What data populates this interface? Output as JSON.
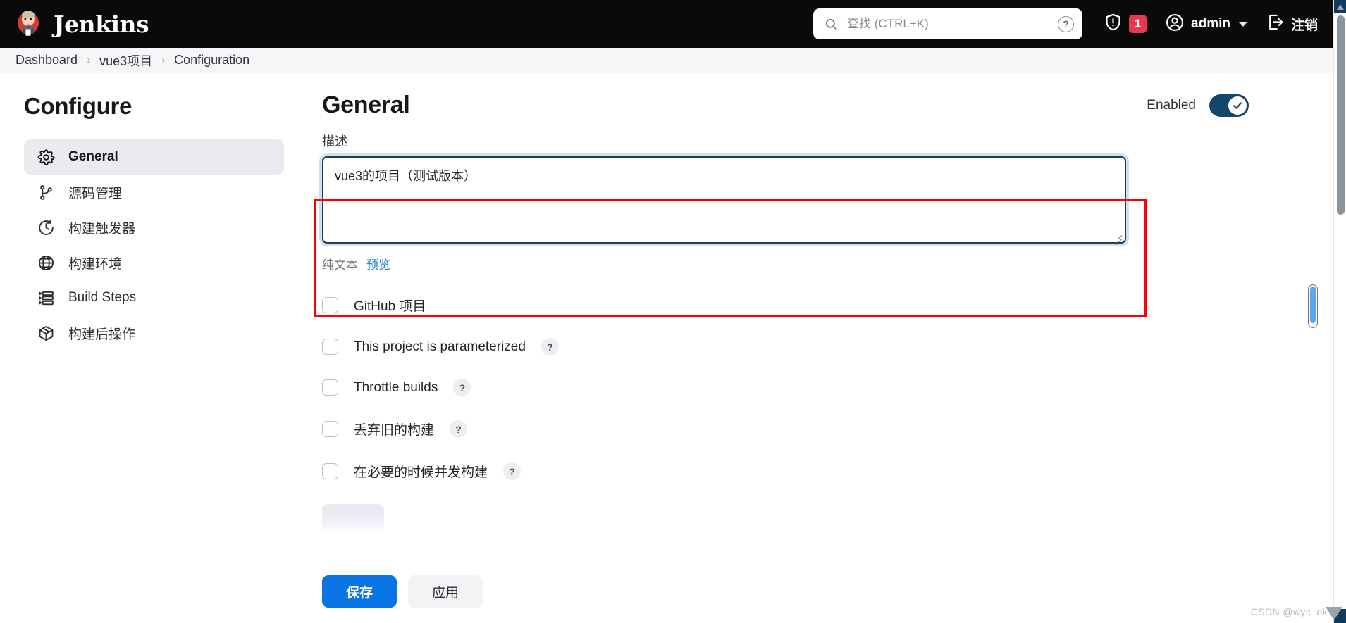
{
  "header": {
    "brand": "Jenkins",
    "search": {
      "placeholder": "查找 (CTRL+K)",
      "value": "",
      "help_label": "?"
    },
    "notifications": {
      "count": "1",
      "icon": "shield-warning-icon"
    },
    "user": {
      "name": "admin",
      "icon": "user-circle-icon"
    },
    "logout": {
      "label": "注销",
      "icon": "logout-icon"
    }
  },
  "breadcrumb": {
    "items": [
      "Dashboard",
      "vue3项目",
      "Configuration"
    ],
    "separator": "›"
  },
  "sidebar": {
    "title": "Configure",
    "items": [
      {
        "label": "General",
        "icon": "gear-icon",
        "active": true
      },
      {
        "label": "源码管理",
        "icon": "git-branch-icon",
        "active": false
      },
      {
        "label": "构建触发器",
        "icon": "clock-icon",
        "active": false
      },
      {
        "label": "构建环境",
        "icon": "globe-icon",
        "active": false
      },
      {
        "label": "Build Steps",
        "icon": "list-steps-icon",
        "active": false
      },
      {
        "label": "构建后操作",
        "icon": "package-box-icon",
        "active": false
      }
    ]
  },
  "main": {
    "title": "General",
    "enabled_toggle": {
      "label": "Enabled",
      "checked": true,
      "color": "#14456b"
    },
    "description": {
      "label": "描述",
      "value": "vue3的项目（测试版本）",
      "plain_text_label": "纯文本",
      "preview_label": "预览"
    },
    "checkboxes": [
      {
        "label": "GitHub 项目",
        "checked": false,
        "help": false
      },
      {
        "label": "This project is parameterized",
        "checked": false,
        "help": true,
        "help_label": "?"
      },
      {
        "label": "Throttle builds",
        "checked": false,
        "help": true,
        "help_label": "?"
      },
      {
        "label": "丢弃旧的构建",
        "checked": false,
        "help": true,
        "help_label": "?"
      },
      {
        "label": "在必要的时候并发构建",
        "checked": false,
        "help": true,
        "help_label": "?"
      }
    ]
  },
  "actions": {
    "save_label": "保存",
    "apply_label": "应用",
    "save_color": "#0b74e5"
  },
  "annotation": {
    "color": "#fe0000"
  },
  "watermark": {
    "text": "CSDN @wyc_ok"
  }
}
